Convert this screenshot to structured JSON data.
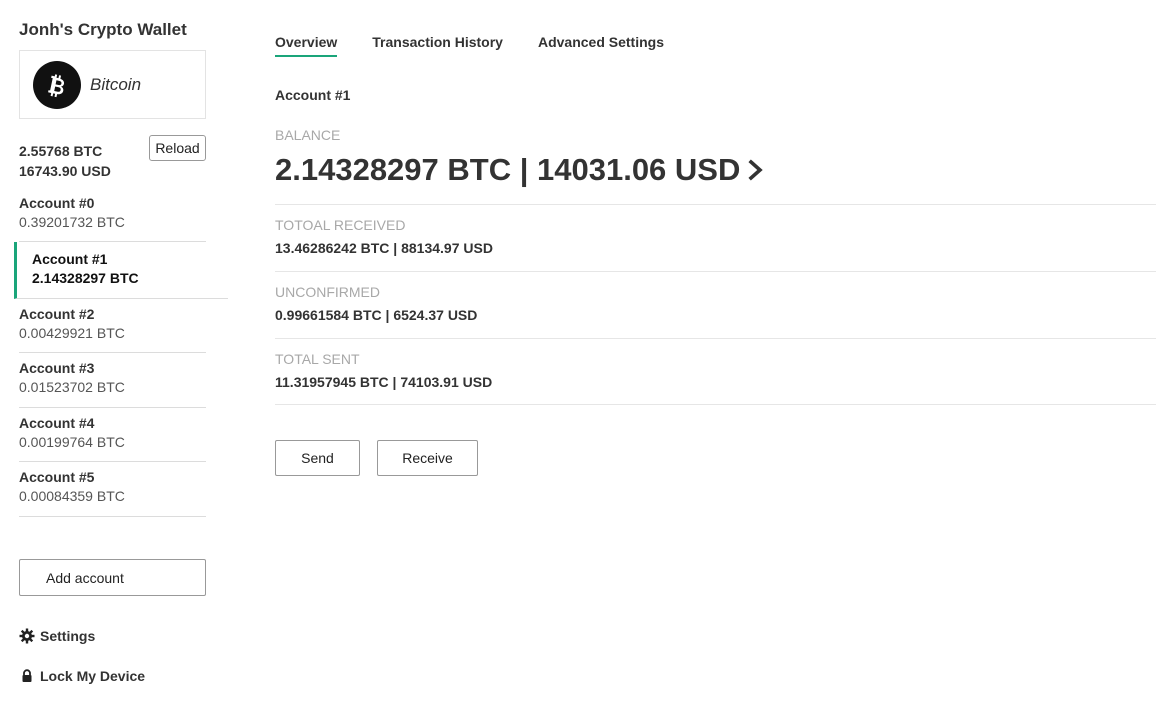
{
  "sidebar": {
    "wallet_title": "Jonh's Crypto Wallet",
    "coin_name": "Bitcoin",
    "total_btc": "2.55768 BTC",
    "total_usd": "16743.90 USD",
    "reload_label": "Reload",
    "accounts": [
      {
        "name": "Account #0",
        "balance": "0.39201732 BTC"
      },
      {
        "name": "Account #1",
        "balance": "2.14328297 BTC"
      },
      {
        "name": "Account #2",
        "balance": "0.00429921 BTC"
      },
      {
        "name": "Account #3",
        "balance": "0.01523702 BTC"
      },
      {
        "name": "Account #4",
        "balance": "0.00199764 BTC"
      },
      {
        "name": "Account #5",
        "balance": "0.00084359 BTC"
      }
    ],
    "selected_account_index": 1,
    "add_account_label": "Add account",
    "settings_label": "Settings",
    "lock_label": "Lock My Device"
  },
  "main": {
    "tabs": [
      {
        "label": "Overview",
        "active": true
      },
      {
        "label": "Transaction History",
        "active": false
      },
      {
        "label": "Advanced Settings",
        "active": false
      }
    ],
    "account_heading": "Account #1",
    "balance_label": "BALANCE",
    "balance_value": "2.14328297 BTC | 14031.06 USD",
    "stats": [
      {
        "label": "TOTOAL RECEIVED",
        "value": "13.46286242 BTC | 88134.97 USD"
      },
      {
        "label": "UNCONFIRMED",
        "value": "0.99661584 BTC | 6524.37 USD"
      },
      {
        "label": "TOTAL SENT",
        "value": "11.31957945 BTC | 74103.91 USD"
      }
    ],
    "send_label": "Send",
    "receive_label": "Receive"
  },
  "colors": {
    "accent": "#1aa57a",
    "text": "#333333",
    "muted_label": "#a8a8a8",
    "coin_icon_bg": "#111111"
  },
  "icons": {
    "coin": "bitcoin-icon",
    "settings": "gear-icon",
    "lock": "lock-icon",
    "balance_arrow": "chevron-right-icon"
  }
}
